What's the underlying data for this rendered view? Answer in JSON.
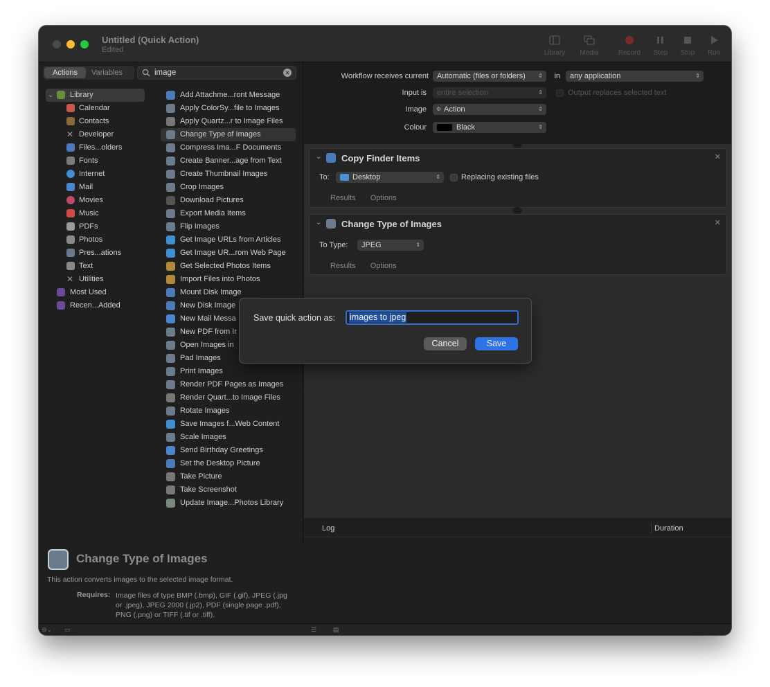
{
  "window": {
    "title": "Untitled (Quick Action)",
    "subtitle": "Edited"
  },
  "toolbar": {
    "library": "Library",
    "media": "Media",
    "record": "Record",
    "step": "Step",
    "stop": "Stop",
    "run": "Run"
  },
  "left": {
    "tab_actions": "Actions",
    "tab_variables": "Variables",
    "search_value": "image",
    "library_root": "Library",
    "library": [
      "Calendar",
      "Contacts",
      "Developer",
      "Files...olders",
      "Fonts",
      "Internet",
      "Mail",
      "Movies",
      "Music",
      "PDFs",
      "Photos",
      "Pres...ations",
      "Text",
      "Utilities"
    ],
    "extra": [
      "Most Used",
      "Recen...Added"
    ],
    "actions": [
      "Add Attachme...ront Message",
      "Apply ColorSy...file to Images",
      "Apply Quartz...r to Image Files",
      "Change Type of Images",
      "Compress Ima...F Documents",
      "Create Banner...age from Text",
      "Create Thumbnail Images",
      "Crop Images",
      "Download Pictures",
      "Export Media Items",
      "Flip Images",
      "Get Image URLs from Articles",
      "Get Image UR...rom Web Page",
      "Get Selected Photos Items",
      "Import Files into Photos",
      "Mount Disk Image",
      "New Disk Image",
      "New Mail Messa",
      "New PDF from Ir",
      "Open Images in",
      "Pad Images",
      "Print Images",
      "Render PDF Pages as Images",
      "Render Quart...to Image Files",
      "Rotate Images",
      "Save Images f...Web Content",
      "Scale Images",
      "Send Birthday Greetings",
      "Set the Desktop Picture",
      "Take Picture",
      "Take Screenshot",
      "Update Image...Photos Library"
    ],
    "selected_action": "Change Type of Images",
    "description": {
      "title": "Change Type of Images",
      "text": "This action converts images to the selected image format.",
      "requires_label": "Requires:",
      "requires_text": "Image files of type BMP (.bmp), GIF (.gif), JPEG (.jpg or .jpeg), JPEG 2000 (.jp2), PDF (single page .pdf), PNG (.png) or TIFF (.tif or .tiff)."
    }
  },
  "workflow": {
    "receives_label": "Workflow receives current",
    "receives_value": "Automatic (files or folders)",
    "in_label": "in",
    "in_value": "any application",
    "input_is_label": "Input is",
    "input_is_value": "entire selection",
    "output_replaces": "Output replaces selected text",
    "image_label": "Image",
    "image_value": "Action",
    "colour_label": "Colour",
    "colour_value": "Black"
  },
  "cards": {
    "copy": {
      "title": "Copy Finder Items",
      "to_label": "To:",
      "to_value": "Desktop",
      "replacing": "Replacing existing files",
      "results": "Results",
      "options": "Options"
    },
    "change": {
      "title": "Change Type of Images",
      "type_label": "To Type:",
      "type_value": "JPEG",
      "results": "Results",
      "options": "Options"
    }
  },
  "log": {
    "col_log": "Log",
    "col_duration": "Duration"
  },
  "dialog": {
    "label": "Save quick action as:",
    "value": "images to jpeg",
    "cancel": "Cancel",
    "save": "Save"
  },
  "colors": {
    "accent": "#2f72e6",
    "traffic_min": "#febc2e",
    "traffic_max": "#28c840"
  }
}
